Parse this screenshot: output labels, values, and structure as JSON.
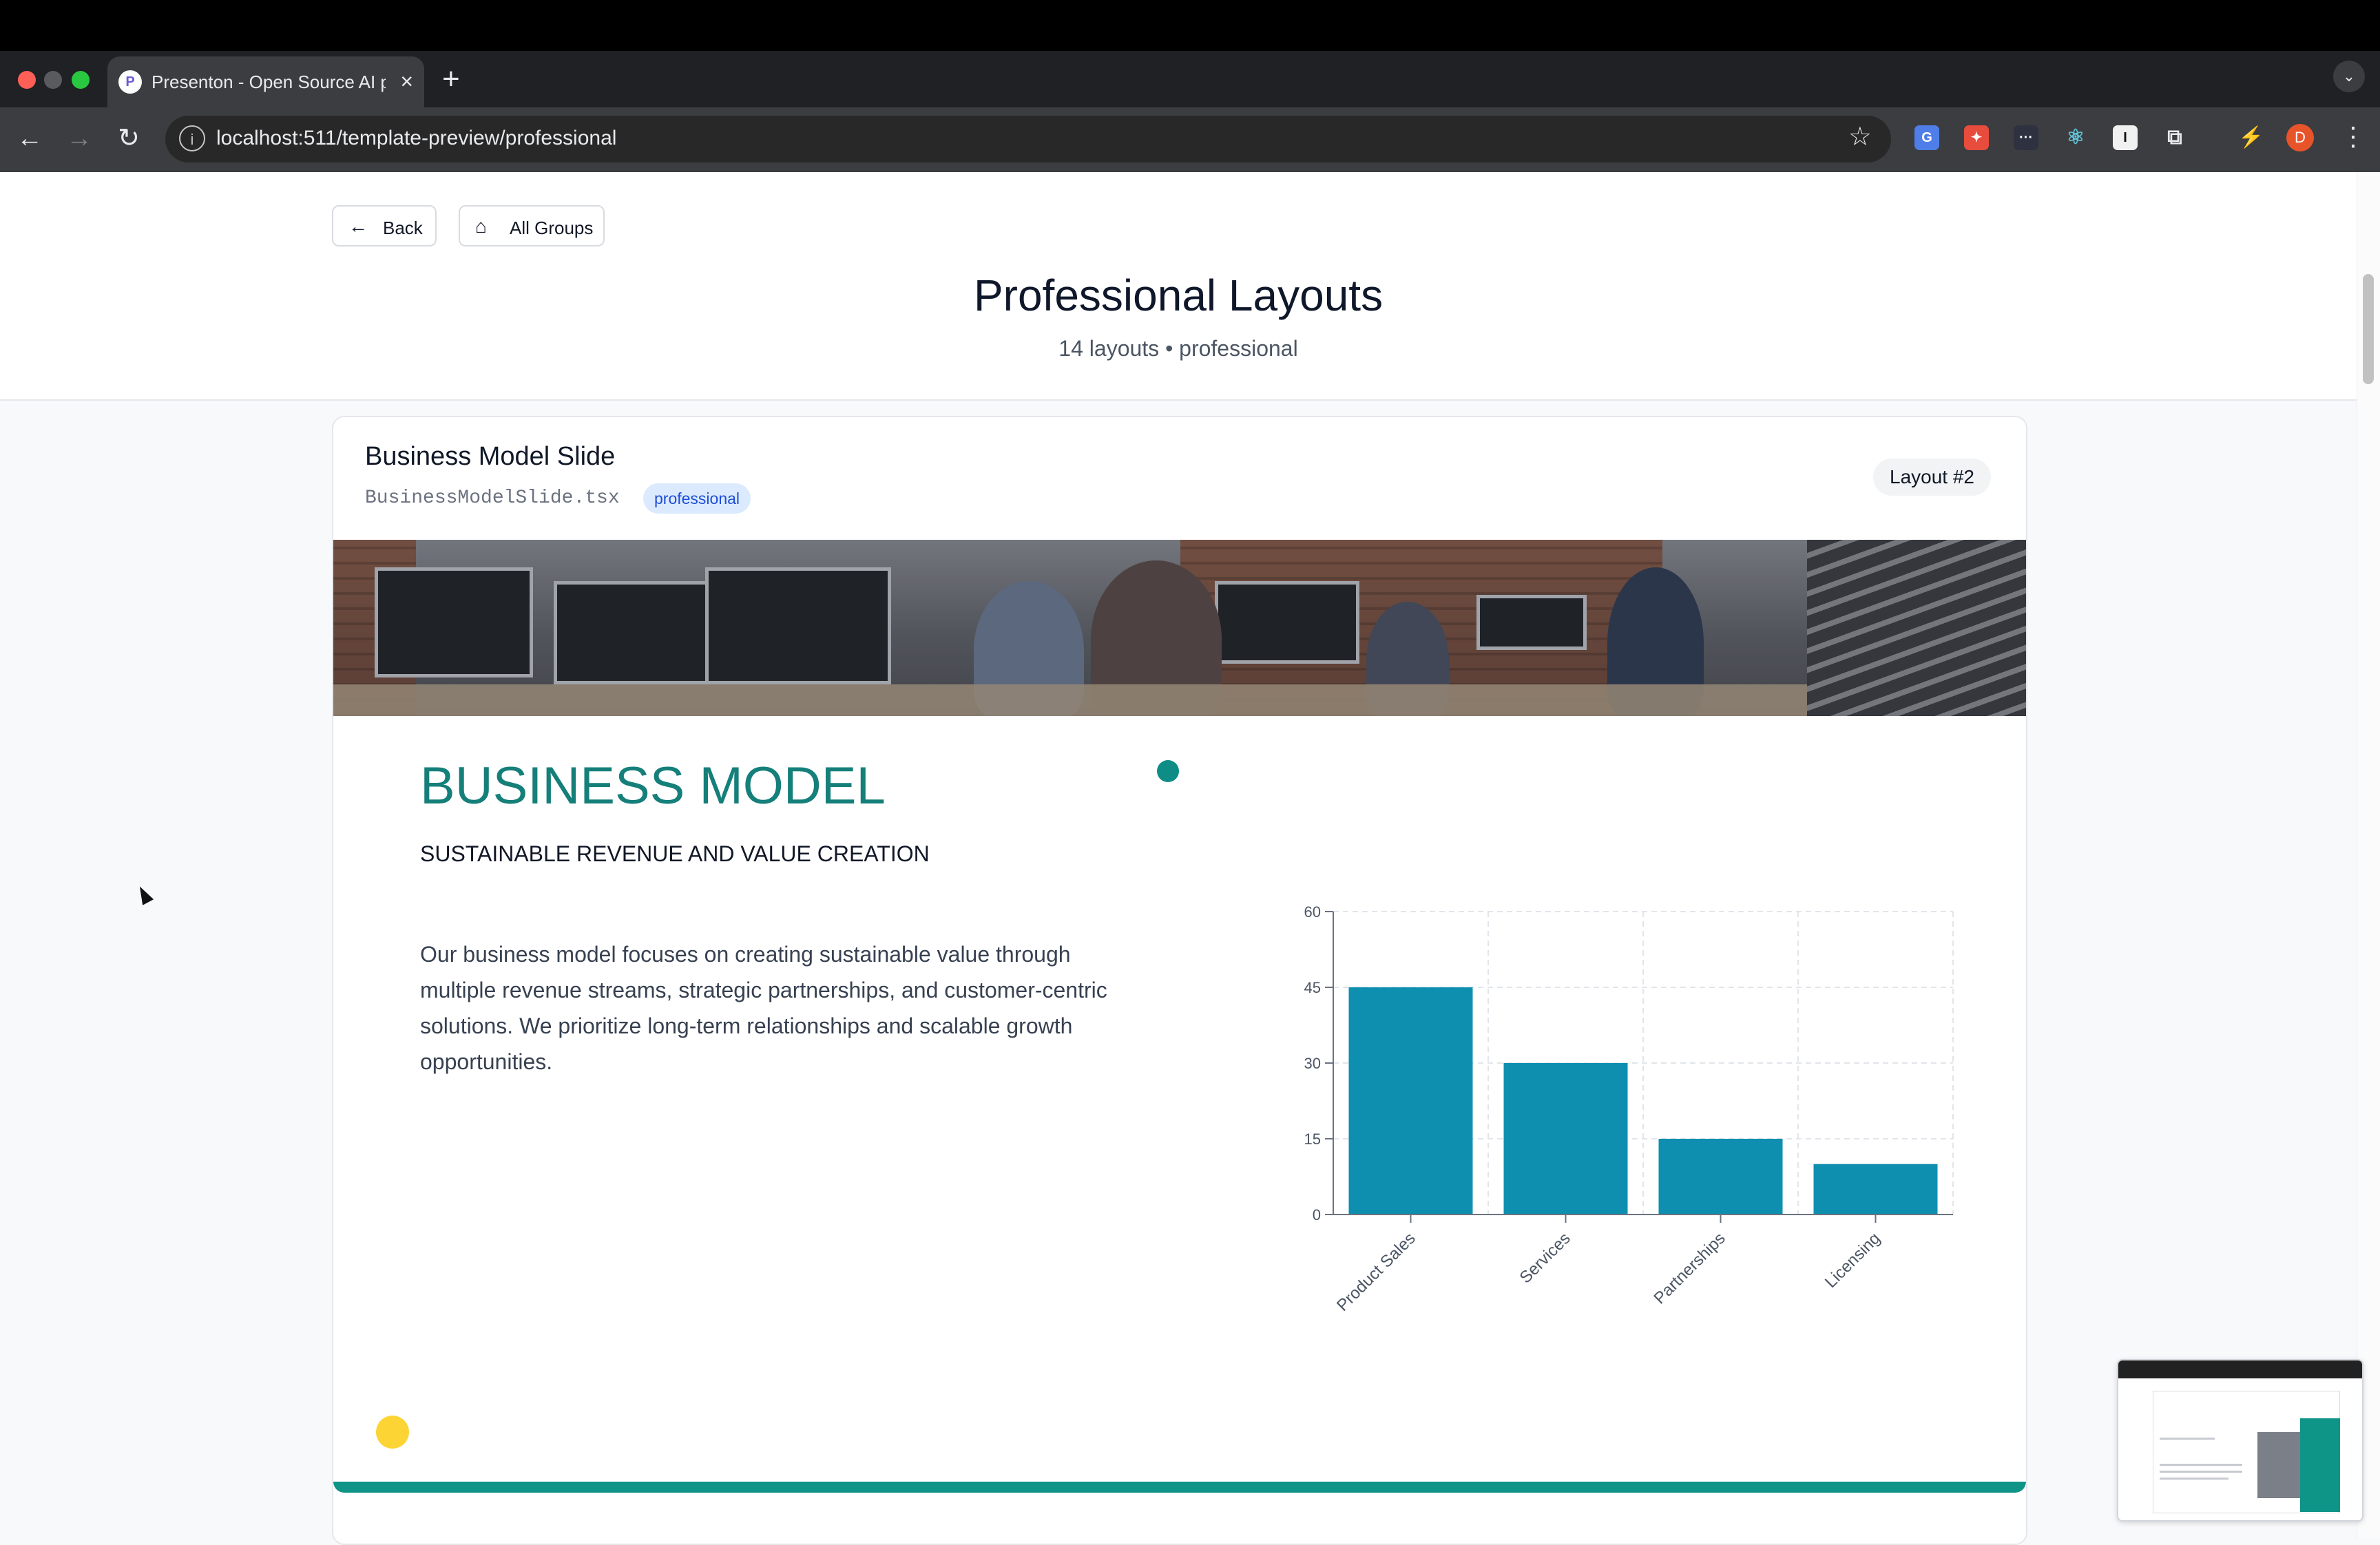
{
  "browser": {
    "tab_title": "Presenton - Open Source AI p",
    "tab_favicon": "P",
    "url": "localhost:511/template-preview/professional",
    "profile_initial": "D",
    "icons": {
      "back": "arrow-left-icon",
      "forward": "arrow-right-icon",
      "reload": "reload-icon",
      "info": "info-icon",
      "star": "star-icon",
      "menu": "more-vertical-icon"
    },
    "colors": {
      "tabstrip": "#202124",
      "toolbar": "#3c3d41",
      "profile": "#e8542a"
    }
  },
  "header": {
    "back_label": "Back",
    "all_groups_label": "All Groups",
    "title": "Professional Layouts",
    "subtitle": "14 layouts • professional"
  },
  "card": {
    "title": "Business Model Slide",
    "filename": "BusinessModelSlide.tsx",
    "badge": "professional",
    "layout_number": "Layout #2"
  },
  "slide": {
    "title": "BUSINESS MODEL",
    "subtitle": "SUSTAINABLE REVENUE AND VALUE CREATION",
    "body": "Our business model focuses on creating sustainable value through multiple revenue streams, strategic partnerships, and customer-centric solutions. We prioritize long-term relationships and scalable growth opportunities.",
    "colors": {
      "accent": "#157f7a",
      "bar": "#0e8fb0",
      "dot_teal": "#0d8d85",
      "dot_yellow": "#fcd535",
      "footer_bar": "#119488"
    }
  },
  "chart_data": {
    "type": "bar",
    "categories": [
      "Product Sales",
      "Services",
      "Partnerships",
      "Licensing"
    ],
    "values": [
      45,
      30,
      15,
      10
    ],
    "yticks": [
      0,
      15,
      30,
      45,
      60
    ],
    "ylim": [
      0,
      60
    ],
    "grid": true,
    "color": "#0e8fb0",
    "title": "",
    "xlabel": "",
    "ylabel": ""
  }
}
